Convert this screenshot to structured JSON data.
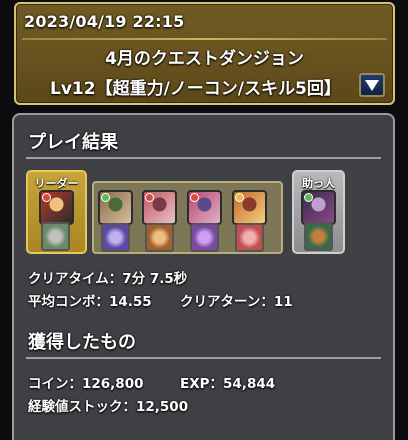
{
  "header": {
    "datetime": "2023/04/19 22:15",
    "title": "4月のクエストダンジョン",
    "subtitle": "Lv12【超重力/ノーコン/スキル5回】"
  },
  "result": {
    "section_title": "プレイ結果",
    "leader_label": "リーダー",
    "helper_label": "助っ人",
    "clear_time": "クリアタイム：7分 7.5秒",
    "avg_combo": "平均コンボ：14.55",
    "clear_turns": "クリアターン：11"
  },
  "rewards": {
    "section_title": "獲得したもの",
    "coin": "コイン：126,800",
    "exp": "EXP：54,844",
    "exp_stock": "経験値ストック：12,500"
  },
  "team": {
    "leader": {
      "icon": "leader-monster-portrait",
      "attribute_color": "#d94a3a",
      "colors": [
        "#b33a2a",
        "#2d2d2d",
        "#f0c27a"
      ]
    },
    "members": [
      {
        "icon": "member-monster-portrait",
        "attribute_color": "#5bbf4e",
        "colors": [
          "#8a6a4a",
          "#d8c0a0",
          "#4d6b3a"
        ]
      },
      {
        "icon": "member-monster-portrait",
        "attribute_color": "#d94a3a",
        "colors": [
          "#c05a60",
          "#e8c0c8",
          "#7a3a4a"
        ]
      },
      {
        "icon": "member-monster-portrait",
        "attribute_color": "#d94a3a",
        "colors": [
          "#b64a70",
          "#e0b0c8",
          "#5a4a8a"
        ]
      },
      {
        "icon": "member-monster-portrait",
        "attribute_color": "#e0c040",
        "colors": [
          "#c46a2a",
          "#f0d080",
          "#8a3a2a"
        ]
      }
    ],
    "helper": {
      "icon": "helper-monster-portrait",
      "attribute_color": "#5bbf4e",
      "colors": [
        "#3a2a4a",
        "#8a4a8a",
        "#c0a0d0"
      ]
    },
    "assists": [
      {
        "icon": "assist-equipment-icon",
        "colors": [
          "#6a8a6a",
          "#c0c0c0"
        ]
      },
      {
        "icon": "assist-equipment-icon",
        "colors": [
          "#5a4aa0",
          "#c0b0f0"
        ]
      },
      {
        "icon": "assist-equipment-icon",
        "colors": [
          "#a06030",
          "#f0c080"
        ]
      },
      {
        "icon": "assist-equipment-icon",
        "colors": [
          "#7a4aa0",
          "#d0a0f0"
        ]
      },
      {
        "icon": "assist-equipment-icon",
        "colors": [
          "#c05050",
          "#f0b0b0"
        ]
      },
      {
        "icon": "assist-equipment-icon",
        "colors": [
          "#3a6a4a",
          "#c08040"
        ]
      }
    ]
  }
}
